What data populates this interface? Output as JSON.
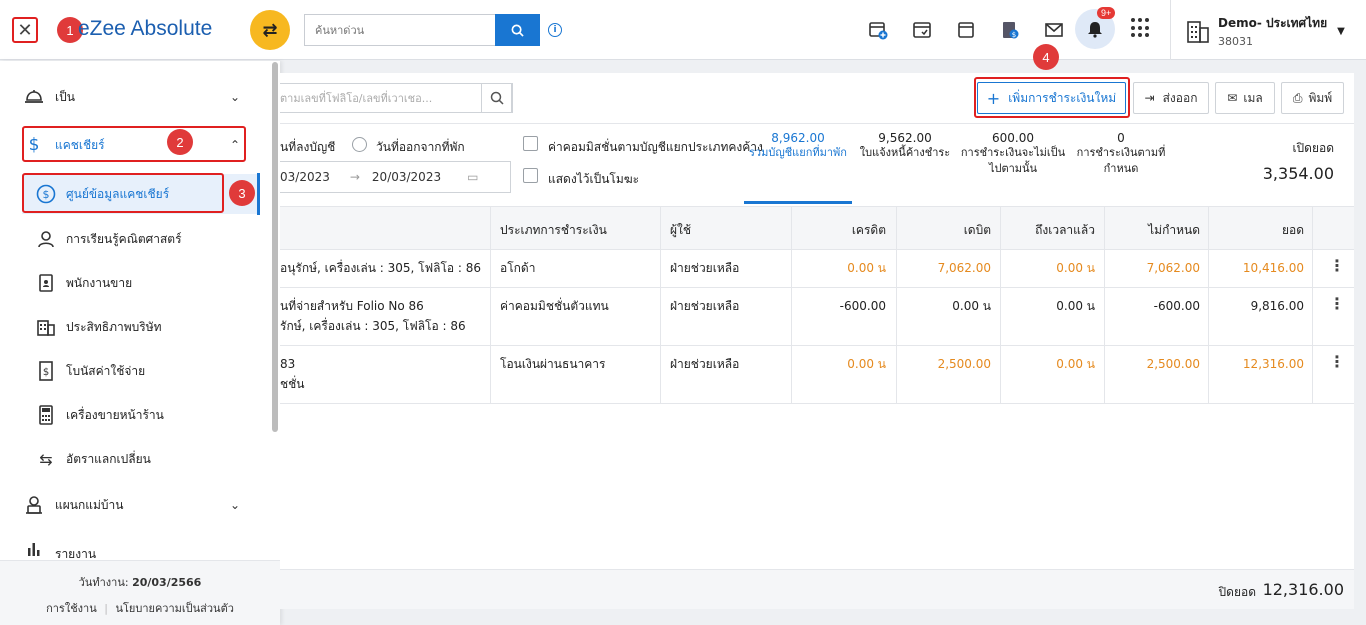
{
  "header": {
    "logo_text": "eZee Absolute",
    "search_placeholder": "ค้นหาด่วน",
    "notification_count": "9+",
    "property_name": "Demo- ประเทศไทย",
    "property_id": "38031"
  },
  "steps": [
    "1",
    "2",
    "3",
    "4"
  ],
  "sidebar": {
    "items": [
      {
        "label": "เป็น",
        "icon": "bell-service-icon"
      },
      {
        "label": "แคชเชียร์",
        "icon": "dollar-icon"
      },
      {
        "label": "ศูนย์ข้อมูลแคชเชียร์",
        "icon": "dollar-circle-icon"
      },
      {
        "label": "การเรียนรู้คณิตศาสตร์",
        "icon": "person-icon"
      },
      {
        "label": "พนักงานขาย",
        "icon": "id-card-icon"
      },
      {
        "label": "ประสิทธิภาพบริษัท",
        "icon": "building-icon"
      },
      {
        "label": "โบนัสค่าใช้จ่าย",
        "icon": "receipt-icon"
      },
      {
        "label": "เครื่องขายหน้าร้าน",
        "icon": "pos-icon"
      },
      {
        "label": "อัตราแลกเปลี่ยน",
        "icon": "exchange-icon"
      },
      {
        "label": "แผนกแม่บ้าน",
        "icon": "housekeeping-icon"
      },
      {
        "label": "รายงาน",
        "icon": "bar-chart-icon"
      }
    ],
    "footer_date_label": "วันทำงาน:",
    "footer_date": "20/03/2566",
    "footer_terms": "การใช้งาน",
    "footer_privacy": "นโยบายความเป็นส่วนตัว"
  },
  "toolbar": {
    "search_placeholder": "ตามเลขที่โฟลิโอ/เลขที่เวาเชอ...",
    "add_payment": "เพิ่มการชำระเงินใหม่",
    "export": "ส่งออก",
    "mail": "เมล",
    "print": "พิมพ์"
  },
  "filters": {
    "posting_date": "นที่ลงบัญชี",
    "checkout_date": "วันที่ออกจากที่พัก",
    "date_from": "03/2023",
    "date_to": "20/03/2023",
    "commission_label": "ค่าคอมมิสชั่นตามบัญชีแยกประเภทคงค้าง",
    "show_void": "แสดงไว้เป็นโมฆะ"
  },
  "stats": [
    {
      "value": "8,962.00",
      "label1": "รวมบัญชีแยกที่มาพัก",
      "label2": ""
    },
    {
      "value": "9,562.00",
      "label1": "ใบแจ้งหนี้ค้างชำระ",
      "label2": ""
    },
    {
      "value": "600.00",
      "label1": "การชำระเงินจะไม่เป็น",
      "label2": "ไปตามนั้น"
    },
    {
      "value": "0",
      "label1": "การชำระเงินตามที่",
      "label2": "กำหนด"
    }
  ],
  "opening": {
    "label": "เปิดยอด",
    "value": "3,354.00"
  },
  "table": {
    "headers": [
      "ประเภทการชำระเงิน",
      "ผู้ใช้",
      "เครดิต",
      "เดบิต",
      "ถึงเวลาแล้ว",
      "ไม่กำหนด",
      "ยอด"
    ],
    "rows": [
      {
        "desc1": "อนุรักษ์, เครื่องเล่น : 305, โฟลิโอ : 86",
        "desc2": "",
        "type": "อโกด้า",
        "user": "ฝ่ายช่วยเหลือ",
        "credit": "0.00 น",
        "debit": "7,062.00",
        "due": "0.00 น",
        "unset": "7,062.00",
        "balance": "10,416.00"
      },
      {
        "desc1": "นที่จ่ายสำหรับ Folio No 86",
        "desc2": "รักษ์, เครื่องเล่น : 305, โฟลิโอ : 86",
        "type": "ค่าคอมมิชชั่นตัวแทน",
        "user": "ฝ่ายช่วยเหลือ",
        "credit": "-600.00",
        "debit": "0.00 น",
        "due": "0.00 น",
        "unset": "-600.00",
        "balance": "9,816.00"
      },
      {
        "desc1": "83",
        "desc2": "ชชั่น",
        "type": "โอนเงินผ่านธนาคาร",
        "user": "ฝ่ายช่วยเหลือ",
        "credit": "0.00 น",
        "debit": "2,500.00",
        "due": "0.00 น",
        "unset": "2,500.00",
        "balance": "12,316.00"
      }
    ]
  },
  "closing": {
    "label": "ปิดยอด",
    "value": "12,316.00"
  }
}
